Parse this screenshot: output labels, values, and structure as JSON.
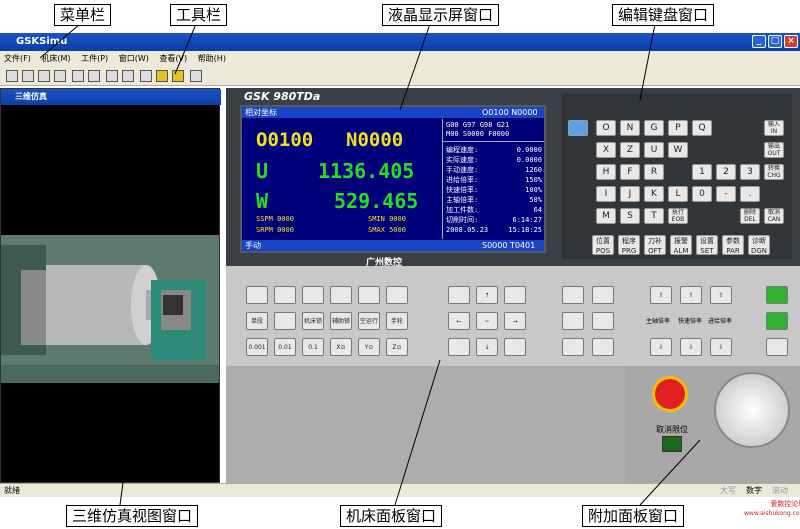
{
  "annotations": {
    "menubar": "菜单栏",
    "toolbar": "工具栏",
    "lcd": "液晶显示屏窗口",
    "keypad": "编辑键盘窗口",
    "sim3d": "三维仿真视图窗口",
    "machine_panel": "机床面板窗口",
    "extra_panel": "附加面板窗口"
  },
  "window": {
    "title": "GSKSimu"
  },
  "menu": [
    "文件(F)",
    "机床(M)",
    "工件(P)",
    "窗口(W)",
    "查看(V)",
    "帮助(H)"
  ],
  "sim": {
    "title": "三维仿真"
  },
  "screen": {
    "brand": "GSK 980TDa",
    "mode": "相对坐标",
    "prog": "O0100 N0000",
    "o": "O0100",
    "n": "N0000",
    "u_label": "U",
    "u_val": "1136.405",
    "w_label": "W",
    "w_val": "529.465",
    "sspm": "SSPM  0000",
    "smin": "SMIN 0000",
    "srpm": "SRPM  0000",
    "smax": "SMAX 5000",
    "g_codes": "G00 G97 G98 G21",
    "m_codes": "M00 S0000 F0000",
    "params": [
      [
        "编程速度:",
        "0.0000"
      ],
      [
        "实际速度:",
        "0.0000"
      ],
      [
        "手动速度:",
        "1260"
      ],
      [
        "进给倍率:",
        "150%"
      ],
      [
        "快速倍率:",
        "100%"
      ],
      [
        "主轴倍率:",
        "50%"
      ],
      [
        "加工件数:",
        "64"
      ],
      [
        "切削时间:",
        "6:14:27"
      ],
      [
        "2008.05.23",
        "15:18:25"
      ]
    ],
    "status_left": "手动",
    "status_right": "S0000 T0401",
    "logo": "广州数控"
  },
  "keys": {
    "rows": [
      [
        "O",
        "N",
        "G",
        "P",
        "Q"
      ],
      [
        "X",
        "Z",
        "U",
        "W"
      ],
      [
        "H",
        "F",
        "R",
        "1",
        "2",
        "3"
      ],
      [
        "I",
        "J",
        "K",
        "L",
        "0",
        "-",
        "."
      ],
      [
        "M",
        "S",
        "T",
        "0"
      ]
    ],
    "side": [
      "输入\nIN",
      "输出\nOUT",
      "转换\nCHG",
      "删除\nDEL",
      "取消\nCAN"
    ],
    "func": [
      "位置\nPOS",
      "程序\nPRG",
      "刀补\nOFT",
      "报警\nALM",
      "设置\nSET",
      "参数\nPAR",
      "诊断\nDGN"
    ],
    "exec": "执行\nEOB"
  },
  "panel": {
    "labels": [
      "单段",
      "机床锁",
      "辅助锁",
      "空运行",
      "手轮",
      "录返"
    ],
    "axis": [
      "X⊙",
      "Y⊙",
      "Z⊙"
    ],
    "steps": [
      "0.001",
      "0.01",
      "0.1"
    ],
    "rate_labels": [
      "主轴倍率",
      "快速倍率",
      "进给倍率"
    ],
    "cancel_limit": "取消限位"
  },
  "statusbar": {
    "left": "就绪",
    "right_a": "大写",
    "right_b": "数字",
    "right_c": "滚动",
    "watermark": "爱数控论坛",
    "watermark_url": "www.aishukong.com"
  }
}
